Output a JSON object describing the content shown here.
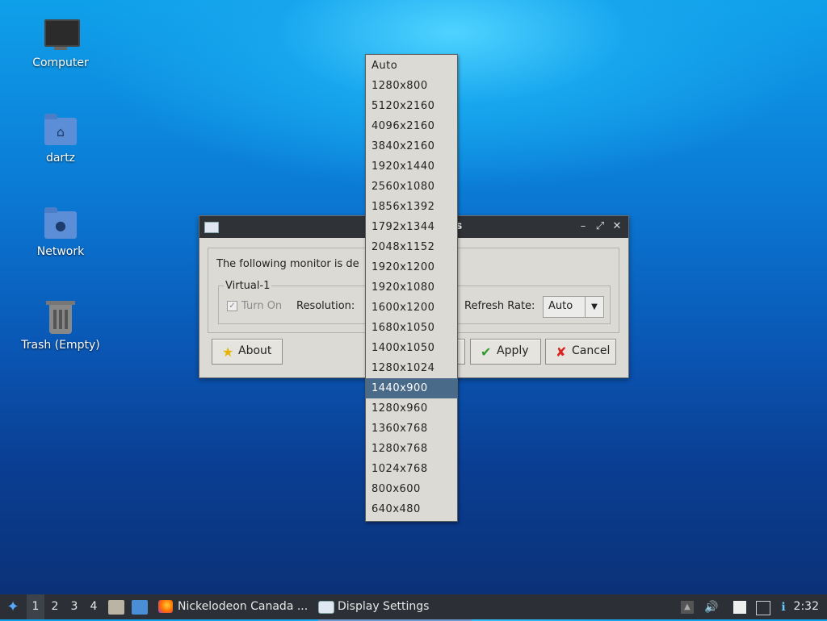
{
  "desktop": {
    "icons": [
      {
        "label": "Computer",
        "icon": "computer-icon"
      },
      {
        "label": "dartz",
        "icon": "home-folder-icon"
      },
      {
        "label": "Network",
        "icon": "network-folder-icon"
      },
      {
        "label": "Trash (Empty)",
        "icon": "trash-icon"
      }
    ]
  },
  "dialog": {
    "title": "Display Settings",
    "intro": "The following monitor is de",
    "group_title": "Virtual-1",
    "turn_on": "Turn On",
    "resolution_label": "Resolution:",
    "refresh_label": "Refresh Rate:",
    "refresh_value": "Auto",
    "buttons": {
      "about": "About",
      "apply": "Apply",
      "cancel": "Cancel"
    },
    "titlebar_buttons": {
      "minimize": "–",
      "maximize": "⤢",
      "close": "✕"
    }
  },
  "resolution_options": [
    "Auto",
    "1280x800",
    "5120x2160",
    "4096x2160",
    "3840x2160",
    "1920x1440",
    "2560x1080",
    "1856x1392",
    "1792x1344",
    "2048x1152",
    "1920x1200",
    "1920x1080",
    "1600x1200",
    "1680x1050",
    "1400x1050",
    "1280x1024",
    "1440x900",
    "1280x960",
    "1360x768",
    "1280x768",
    "1024x768",
    "800x600",
    "640x480"
  ],
  "selected_resolution": "1440x900",
  "taskbar": {
    "workspaces": [
      "1",
      "2",
      "3",
      "4"
    ],
    "active_workspace": "1",
    "tasks": [
      {
        "label": "Nickelodeon Canada ...",
        "icon": "firefox-icon"
      },
      {
        "label": "Display Settings",
        "icon": "window-icon"
      }
    ],
    "clock": "2:32"
  },
  "colors": {
    "selection": "#4a6a8a",
    "taskbar": "#2c3036",
    "titlebar": "#2f3237"
  }
}
